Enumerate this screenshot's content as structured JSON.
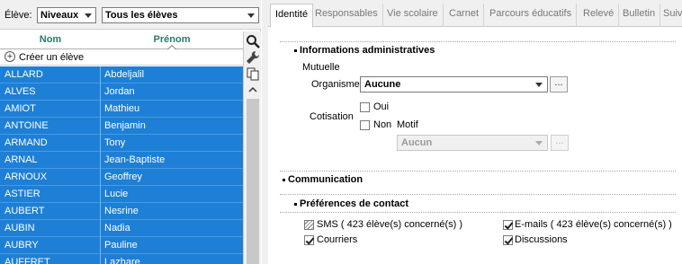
{
  "left_panel": {
    "eleve_label": "Élève:",
    "level_dropdown": "Niveaux",
    "students_dropdown": "Tous les élèves",
    "columns": {
      "nom": "Nom",
      "prenom": "Prénom"
    },
    "create_label": "Créer un élève",
    "students": [
      {
        "nom": "ALLARD",
        "prenom": "Abdeljalil"
      },
      {
        "nom": "ALVES",
        "prenom": "Jordan"
      },
      {
        "nom": "AMIOT",
        "prenom": "Mathieu"
      },
      {
        "nom": "ANTOINE",
        "prenom": "Benjamin"
      },
      {
        "nom": "ARMAND",
        "prenom": "Tony"
      },
      {
        "nom": "ARNAL",
        "prenom": "Jean-Baptiste"
      },
      {
        "nom": "ARNOUX",
        "prenom": "Geoffrey"
      },
      {
        "nom": "ASTIER",
        "prenom": "Lucie"
      },
      {
        "nom": "AUBERT",
        "prenom": "Nesrine"
      },
      {
        "nom": "AUBIN",
        "prenom": "Nadia"
      },
      {
        "nom": "AUBRY",
        "prenom": "Pauline"
      },
      {
        "nom": "AUFFRET",
        "prenom": "Lazhare"
      }
    ]
  },
  "tabs": [
    "Identité",
    "Responsables",
    "Vie scolaire",
    "Carnet",
    "Parcours éducatifs",
    "Relevé",
    "Bulletin",
    "Suiv"
  ],
  "active_tab": "Identité",
  "identite": {
    "admin_section": "Informations administratives",
    "mutuelle_label": "Mutuelle",
    "organisme_label": "Organisme",
    "organisme_value": "Aucune",
    "cotisation_label": "Cotisation",
    "oui_label": "Oui",
    "non_label": "Non",
    "motif_label": "Motif",
    "motif_value": "Aucun",
    "dots": "...",
    "communication_section": "Communication",
    "preferences_section": "Préférences de contact",
    "sms_label": "SMS ( 423 élève(s) concerné(s) )",
    "emails_label": "E-mails ( 423 élève(s) concerné(s) )",
    "courriers_label": "Courriers",
    "discussions_label": "Discussions"
  },
  "colors": {
    "selection": "#1e7fd6",
    "header_text": "#2a7a6a"
  }
}
